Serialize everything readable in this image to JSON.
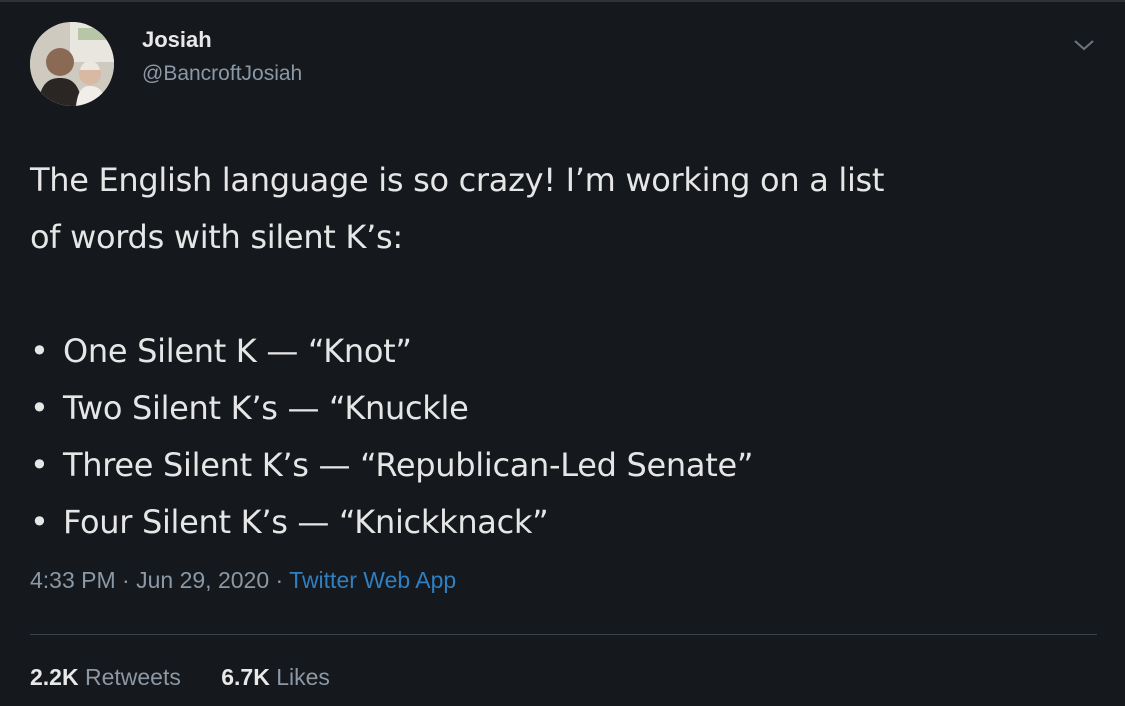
{
  "author": {
    "name": "Josiah",
    "handle": "@BancroftJosiah"
  },
  "tweet": {
    "intro_line1": "The English language is so crazy! I’m working on a list",
    "intro_line2": "of words with silent K’s:",
    "bullets": [
      "One Silent K — “Knot”",
      "Two Silent K’s — “Knuckle",
      "Three Silent K’s — “Republican-Led Senate”",
      "Four Silent K’s — “Knickknack”"
    ],
    "bullet_glyph": "•"
  },
  "meta": {
    "time": "4:33 PM",
    "separator": "·",
    "date": "Jun 29, 2020",
    "source": "Twitter Web App"
  },
  "stats": {
    "retweets_count": "2.2K",
    "retweets_label": "Retweets",
    "likes_count": "6.7K",
    "likes_label": "Likes"
  },
  "colors": {
    "background": "#15181c",
    "text": "#e6e6e6",
    "secondary": "#8b98a5",
    "link": "#2f7fc1"
  },
  "icons": {
    "menu": "chevron-down-icon"
  }
}
